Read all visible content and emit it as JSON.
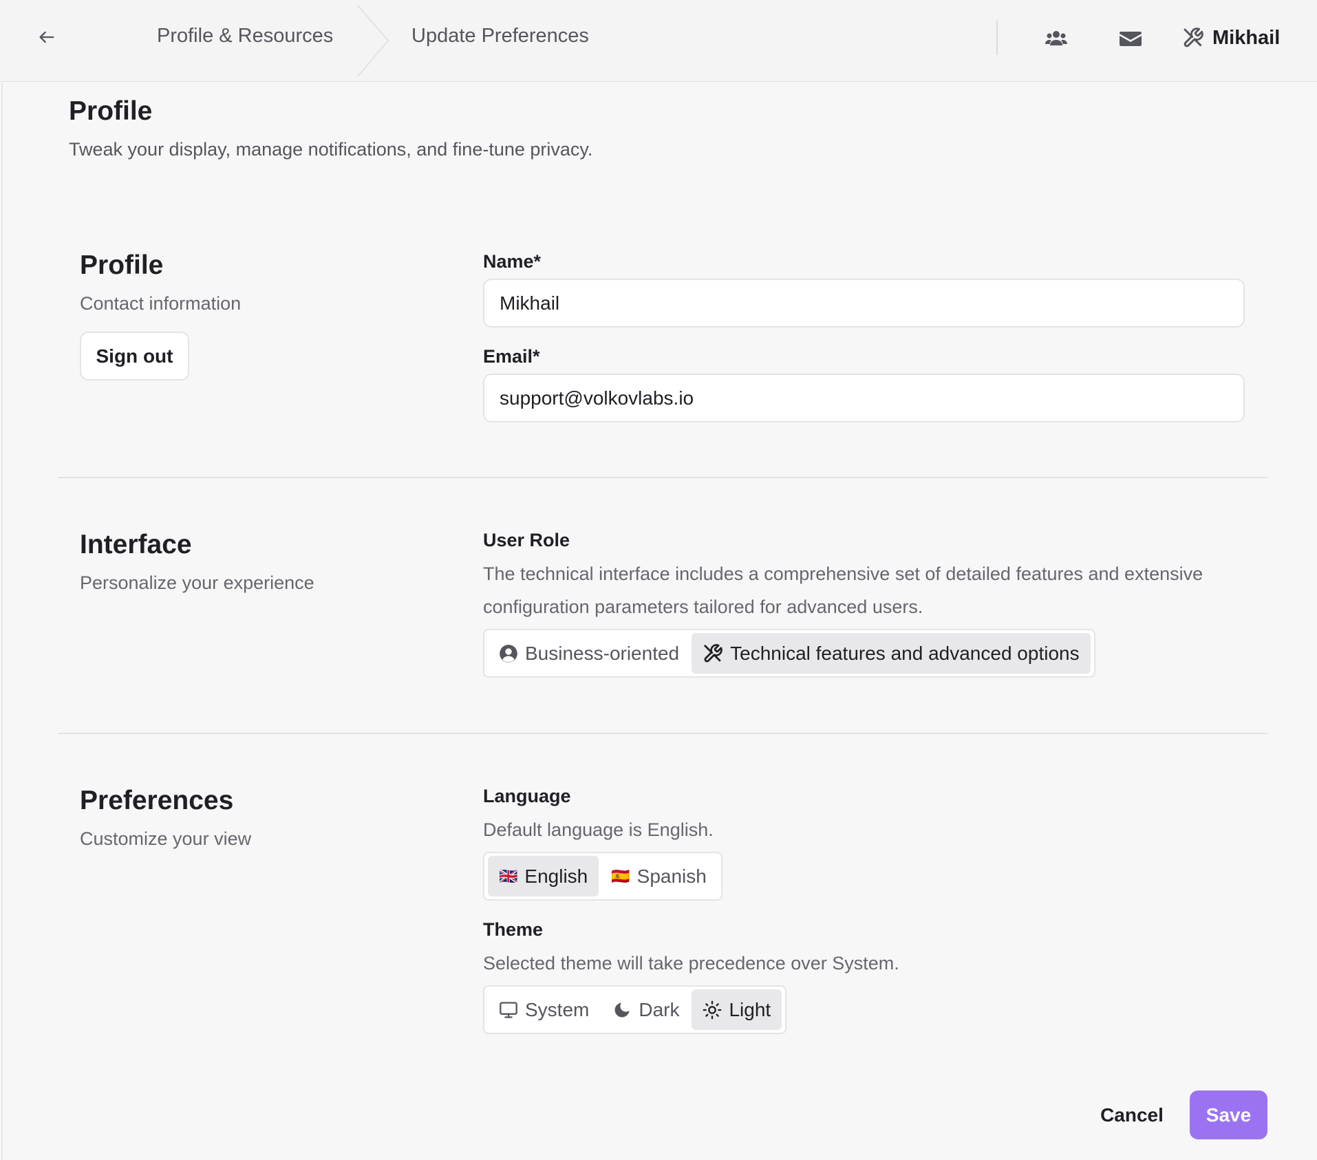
{
  "header": {
    "breadcrumbs": [
      "Profile & Resources",
      "Update Preferences"
    ],
    "user_name": "Mikhail",
    "icons": {
      "back": "arrow-left-icon",
      "team": "users-icon",
      "mail": "envelope-icon",
      "user": "tools-icon"
    }
  },
  "page": {
    "title": "Profile",
    "subtitle": "Tweak your display, manage notifications, and fine-tune privacy."
  },
  "profile_section": {
    "title": "Profile",
    "subtitle": "Contact information",
    "sign_out_label": "Sign out",
    "name_label": "Name*",
    "name_value": "Mikhail",
    "email_label": "Email*",
    "email_value": "support@volkovlabs.io"
  },
  "interface_section": {
    "title": "Interface",
    "subtitle": "Personalize your experience",
    "role_label": "User Role",
    "role_help": "The technical interface includes a comprehensive set of detailed features and extensive configuration parameters tailored for advanced users.",
    "role_options": [
      {
        "label": "Business-oriented",
        "icon": "user-circle-icon",
        "selected": false
      },
      {
        "label": "Technical features and advanced options",
        "icon": "tools-icon",
        "selected": true
      }
    ]
  },
  "preferences_section": {
    "title": "Preferences",
    "subtitle": "Customize your view",
    "language_label": "Language",
    "language_help": "Default language is English.",
    "language_options": [
      {
        "label": "English",
        "flag": "🇬🇧",
        "selected": true
      },
      {
        "label": "Spanish",
        "flag": "🇪🇸",
        "selected": false
      }
    ],
    "theme_label": "Theme",
    "theme_help": "Selected theme will take precedence over System.",
    "theme_options": [
      {
        "label": "System",
        "icon": "monitor-icon",
        "selected": false
      },
      {
        "label": "Dark",
        "icon": "moon-icon",
        "selected": false
      },
      {
        "label": "Light",
        "icon": "sun-icon",
        "selected": true
      }
    ]
  },
  "footer": {
    "cancel_label": "Cancel",
    "save_label": "Save"
  },
  "colors": {
    "accent": "#9b73f2",
    "background": "#f7f7f8",
    "header_bg": "#f4f4f5"
  }
}
